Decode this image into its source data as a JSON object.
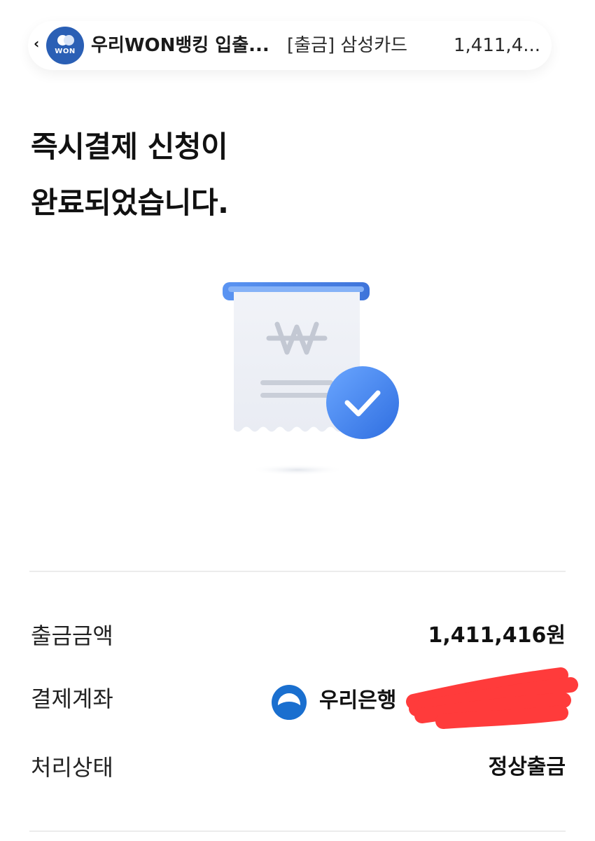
{
  "notification": {
    "back_glyph": "‹",
    "app_logo_text": "WON",
    "app_name": "우리WON뱅킹 입출...",
    "message": "[출금] 삼성카드",
    "amount": "1,411,4..."
  },
  "title": {
    "line1": "즉시결제 신청이",
    "line2": "완료되었습니다."
  },
  "illustration": {
    "icon": "receipt-check-icon",
    "currency_glyph": "₩"
  },
  "details": {
    "rows": [
      {
        "label": "출금금액",
        "value": "1,411,416원"
      },
      {
        "label": "결제계좌",
        "bank_name": "우리은행"
      },
      {
        "label": "처리상태",
        "value": "정상출금"
      }
    ]
  },
  "colors": {
    "accent_blue": "#4a8df0",
    "bank_blue": "#1a6fcf",
    "redaction_red": "#ff3b3b"
  }
}
